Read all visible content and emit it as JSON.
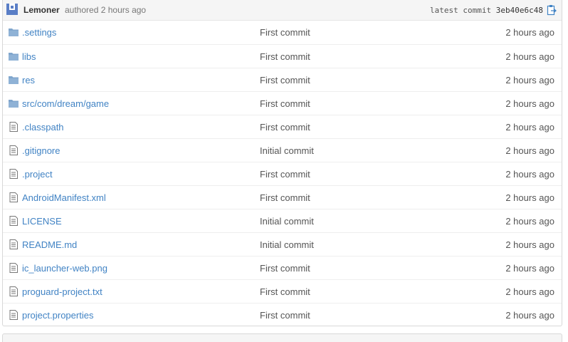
{
  "commit": {
    "author": "Lemoner",
    "authored_text": "authored 2 hours ago",
    "latest_label": "latest commit",
    "sha": "3eb40e6c48"
  },
  "rows": [
    {
      "type": "folder",
      "name": ".settings",
      "message": "First commit",
      "age": "2 hours ago"
    },
    {
      "type": "folder",
      "name": "libs",
      "message": "First commit",
      "age": "2 hours ago"
    },
    {
      "type": "folder",
      "name": "res",
      "message": "First commit",
      "age": "2 hours ago"
    },
    {
      "type": "folder",
      "name": "src/com/dream/game",
      "message": "First commit",
      "age": "2 hours ago"
    },
    {
      "type": "file",
      "name": ".classpath",
      "message": "First commit",
      "age": "2 hours ago"
    },
    {
      "type": "file",
      "name": ".gitignore",
      "message": "Initial commit",
      "age": "2 hours ago"
    },
    {
      "type": "file",
      "name": ".project",
      "message": "First commit",
      "age": "2 hours ago"
    },
    {
      "type": "file",
      "name": "AndroidManifest.xml",
      "message": "First commit",
      "age": "2 hours ago"
    },
    {
      "type": "file",
      "name": "LICENSE",
      "message": "Initial commit",
      "age": "2 hours ago"
    },
    {
      "type": "file",
      "name": "README.md",
      "message": "Initial commit",
      "age": "2 hours ago"
    },
    {
      "type": "file",
      "name": "ic_launcher-web.png",
      "message": "First commit",
      "age": "2 hours ago"
    },
    {
      "type": "file",
      "name": "proguard-project.txt",
      "message": "First commit",
      "age": "2 hours ago"
    },
    {
      "type": "file",
      "name": "project.properties",
      "message": "First commit",
      "age": "2 hours ago"
    }
  ],
  "icons": {
    "avatar": "avatar-identicon",
    "folder": "folder-icon",
    "file": "file-text-icon",
    "clipboard": "clipboard-icon"
  },
  "colors": {
    "link": "#4183c4",
    "folder": "#80a6cd",
    "avatar": "#5a7ec6"
  }
}
